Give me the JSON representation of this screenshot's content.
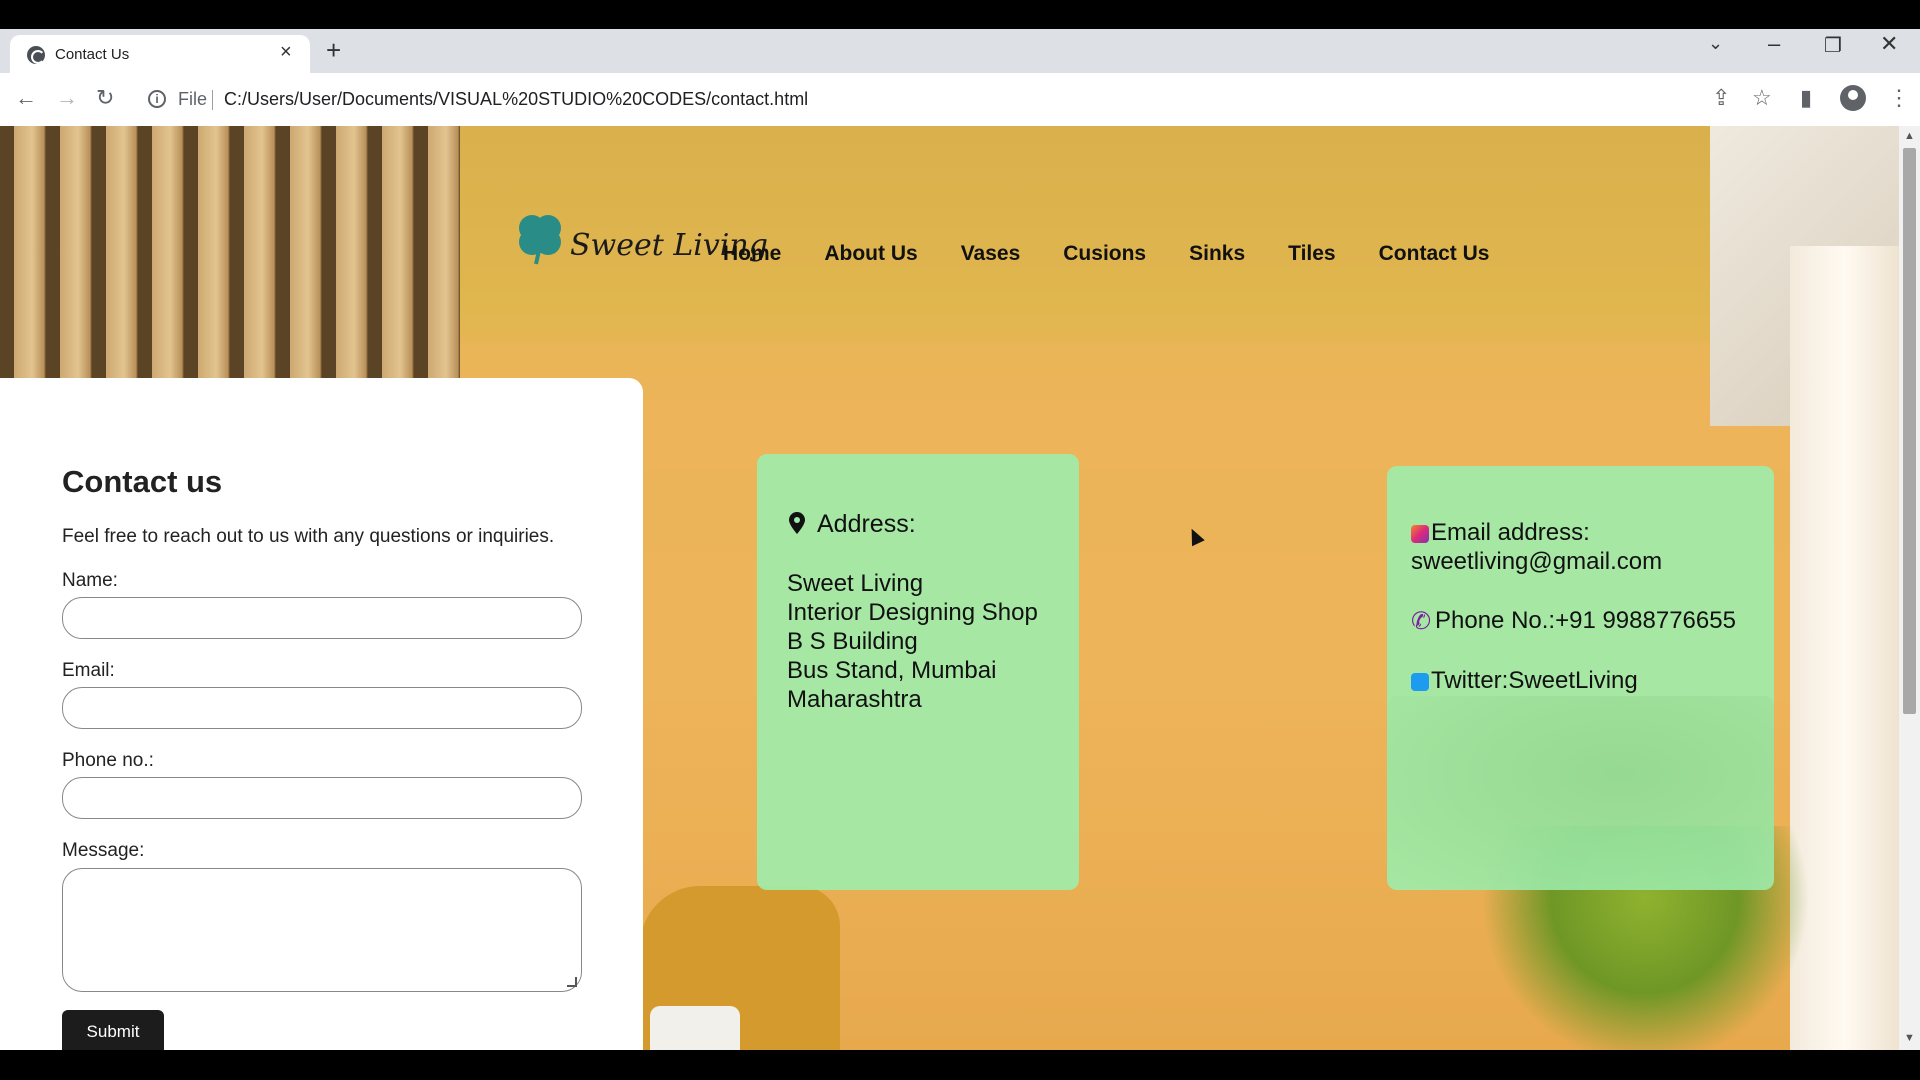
{
  "browser": {
    "tab_title": "Contact Us",
    "scheme_label": "File",
    "url": "C:/Users/User/Documents/VISUAL%20STUDIO%20CODES/contact.html"
  },
  "site": {
    "logo_text": "Sweet Living",
    "nav": [
      "Home",
      "About Us",
      "Vases",
      "Cusions",
      "Sinks",
      "Tiles",
      "Contact Us"
    ]
  },
  "form": {
    "title": "Contact us",
    "intro": "Feel free to reach out to us with any questions or inquiries.",
    "name_label": "Name:",
    "email_label": "Email:",
    "phone_label": "Phone no.:",
    "message_label": "Message:",
    "submit_label": "Submit"
  },
  "address_card": {
    "heading": "Address:",
    "lines": [
      "Sweet Living",
      "Interior Designing Shop",
      "B S Building",
      "Bus Stand, Mumbai",
      "Maharashtra"
    ]
  },
  "contact_card": {
    "email_heading": "Email address:",
    "email": "sweetliving@gmail.com",
    "phone": "Phone No.:+91 9988776655",
    "twitter": "Twitter:SweetLiving"
  },
  "icons": {
    "tab_favicon": "globe-icon",
    "pin": "map-pin-icon",
    "email": "instagram-icon",
    "phone": "phone-icon",
    "twitter": "twitter-icon"
  },
  "colors": {
    "card_bg": "#a0ebaa",
    "submit_bg": "#1c1c1c",
    "page_wall": "#eeb45a"
  }
}
